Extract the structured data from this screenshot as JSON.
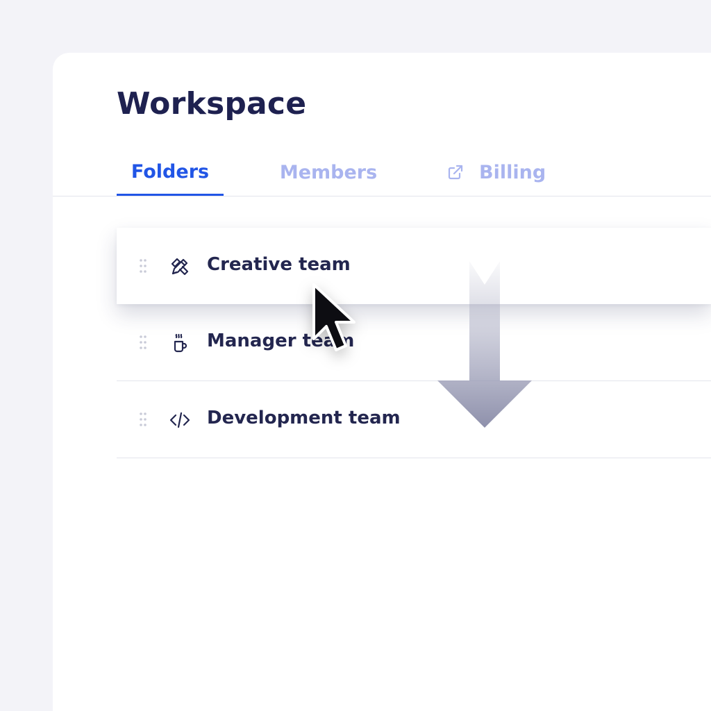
{
  "header": {
    "title": "Workspace"
  },
  "tabs": [
    {
      "label": "Folders",
      "active": true
    },
    {
      "label": "Members",
      "active": false
    },
    {
      "label": "Billing",
      "active": false,
      "icon": "external-link-icon"
    }
  ],
  "folders": [
    {
      "label": "Creative team",
      "icon": "pencil-ruler-icon",
      "state": "dragging"
    },
    {
      "label": "Manager team",
      "icon": "coffee-cup-icon"
    },
    {
      "label": "Development team",
      "icon": "code-icon"
    }
  ],
  "colors": {
    "accent": "#2155e6",
    "inactive_tab": "#a9b4ef",
    "text": "#23264f",
    "title": "#1e2150",
    "background": "#f3f3f8"
  }
}
